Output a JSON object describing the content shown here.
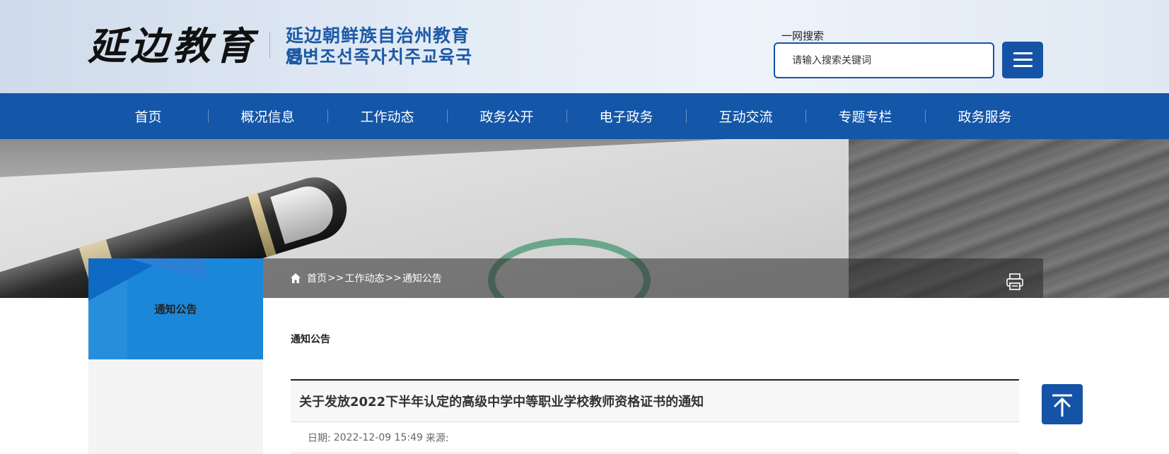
{
  "header": {
    "logo_cn": "延边教育",
    "org_name_cn": "延边朝鲜族自治州教育局",
    "org_name_kr": "연변조선족자치주교육국",
    "search_label": "一网搜索",
    "search_placeholder": "请输入搜索关键词"
  },
  "nav": {
    "items": [
      "首页",
      "概况信息",
      "工作动态",
      "政务公开",
      "电子政务",
      "互动交流",
      "专题专栏",
      "政务服务"
    ]
  },
  "breadcrumb": {
    "home": "首页",
    "sep1": ">>",
    "level1": "工作动态",
    "sep2": ">>",
    "current": "通知公告"
  },
  "sidebar": {
    "title": "通知公告"
  },
  "main": {
    "section_title": "通知公告",
    "article_title": "关于发放2022下半年认定的高级中学中等职业学校教师资格证书的通知",
    "date_label": "日期:",
    "date_value": "2022-12-09 15:49",
    "source_label": "来源:",
    "source_value": ""
  },
  "colors": {
    "brand_blue": "#1456a8",
    "sidebar_blue": "#1a87d9"
  }
}
